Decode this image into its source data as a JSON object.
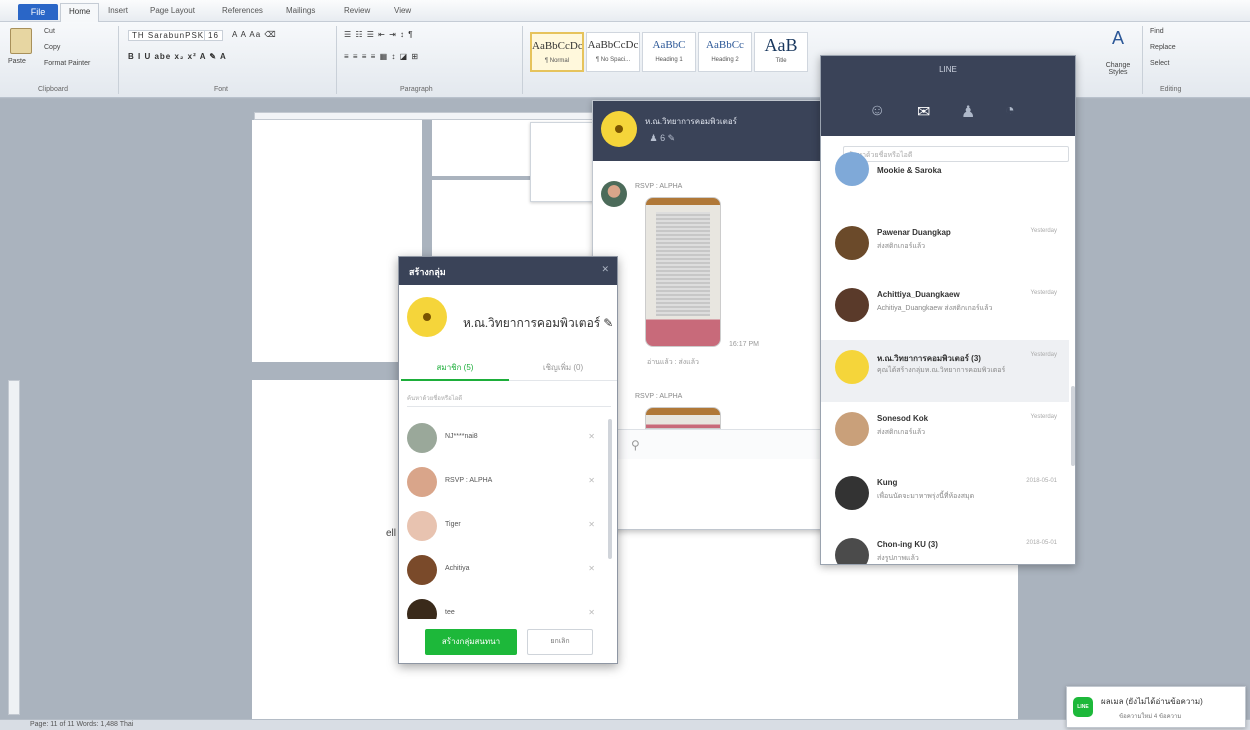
{
  "word": {
    "file_tab": "File",
    "tabs": [
      "Home",
      "Insert",
      "Page Layout",
      "References",
      "Mailings",
      "Review",
      "View"
    ],
    "clipboard": {
      "cut": "Cut",
      "copy": "Copy",
      "paste": "Paste",
      "format_painter": "Format Painter",
      "label": "Clipboard"
    },
    "font": {
      "name": "TH SarabunPSK",
      "size": "16",
      "label": "Font"
    },
    "paragraph_label": "Paragraph",
    "styles": [
      {
        "sample": "AaBbCcDc",
        "name": "¶ Normal"
      },
      {
        "sample": "AaBbCcDc",
        "name": "¶ No Spaci..."
      },
      {
        "sample": "AaBbC",
        "name": "Heading 1"
      },
      {
        "sample": "AaBbCc",
        "name": "Heading 2"
      },
      {
        "sample": "AaB",
        "name": "Title"
      }
    ],
    "change_styles": "Change Styles",
    "editing": {
      "find": "Find",
      "replace": "Replace",
      "select": "Select",
      "label": "Editing"
    },
    "status": "Page: 11 of 11    Words: 1,488    Thai",
    "doc_fragment": "ell"
  },
  "chat": {
    "name": "ห.ณ.วิทยาการคอมพิวเตอร์",
    "sub": " ♟ 6 ✎",
    "sender1": "RSVP : ALPHA",
    "caption1": "อ่านแล้ว : ส่งแล้ว",
    "sender2": "RSVP : ALPHA",
    "time1": "16:17 PM"
  },
  "line": {
    "title": "LINE",
    "search_placeholder": "ค้นหาด้วยชื่อหรือไอดี",
    "friends": [
      {
        "name": "Mookie & Saroka",
        "msg": "",
        "time": "",
        "color": "#7fa9d8"
      },
      {
        "name": "Pawenar Duangkap",
        "msg": "ส่งสติกเกอร์แล้ว",
        "time": "Yesterday",
        "color": "#6b4a2a"
      },
      {
        "name": "Achittiya_Duangkaew",
        "msg": "Achitiya_Duangkaew ส่งสติกเกอร์แล้ว",
        "time": "Yesterday",
        "color": "#5a3a2a"
      },
      {
        "name": "ห.ณ.วิทยาการคอมพิวเตอร์ (3)",
        "msg": "คุณได้สร้างกลุ่มห.ณ.วิทยาการคอมพิวเตอร์",
        "time": "Yesterday",
        "color": "#f5d53a"
      },
      {
        "name": "Sonesod Kok",
        "msg": "ส่งสติกเกอร์แล้ว",
        "time": "Yesterday",
        "color": "#c9a07a"
      },
      {
        "name": "Kung",
        "msg": "เพื่อนนัดจะมาหาพรุ่งนี้ที่ห้องสมุด",
        "time": "2018-05-01",
        "color": "#333333"
      },
      {
        "name": "Chon-ing KU (3)",
        "msg": "ส่งรูปภาพแล้ว",
        "time": "2018-05-01",
        "color": "#4b4b4b"
      }
    ]
  },
  "dialog": {
    "title": "สร้างกลุ่ม",
    "group_name": "ห.ณ.วิทยาการคอมพิวเตอร์ ✎",
    "tab_members": "สมาชิก (5)",
    "tab_invite": "เชิญเพิ่ม (0)",
    "search_placeholder": "ค้นหาด้วยชื่อหรือไอดี",
    "members": [
      {
        "name": "NJ****nai8",
        "color": "#9aa89a"
      },
      {
        "name": "RSVP : ALPHA",
        "color": "#d9a58a"
      },
      {
        "name": "Tiger",
        "color": "#e8c3b0"
      },
      {
        "name": "Achitiya",
        "color": "#7a4a2a"
      },
      {
        "name": "tee",
        "color": "#3a2a1a"
      }
    ],
    "create": "สร้างกลุ่มสนทนา",
    "cancel": "ยกเลิก"
  },
  "toast": {
    "icon": "LINE",
    "title": "ผลเมล (ยังไม่ได้อ่านข้อความ)",
    "sub": "ข้อความใหม่ 4 ข้อความ"
  }
}
